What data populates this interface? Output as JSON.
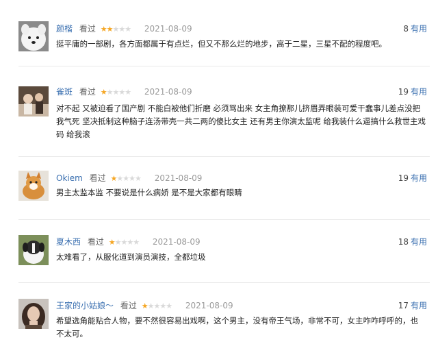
{
  "reviews": [
    {
      "user": "颜楷",
      "watched": "看过",
      "rating": 2,
      "date": "2021-08-09",
      "useful_count": "8",
      "useful_label": "有用",
      "content": "挺平庸的一部剧，各方面都属于有点烂，但又不那么烂的地步，高于二星，三星不配的程度吧。"
    },
    {
      "user": "雀斑",
      "watched": "看过",
      "rating": 1,
      "date": "2021-08-09",
      "useful_count": "19",
      "useful_label": "有用",
      "content": "对不起 又被迫看了国产剧 不能白被他们折磨 必须骂出来 女主角撩那儿挤眉弄眼装可爱干蠢事儿差点没把我气死 坚决抵制这种脑子连汤带壳一共二两的傻比女主 还有男主你演太监呢 给我装什么逼搞什么救世主戏码 给我滚"
    },
    {
      "user": "Okiem",
      "watched": "看过",
      "rating": 1,
      "date": "2021-08-09",
      "useful_count": "19",
      "useful_label": "有用",
      "content": "男主太监本监 不要说是什么病娇 是不是大家都有眼睛"
    },
    {
      "user": "夏木西",
      "watched": "看过",
      "rating": 1,
      "date": "2021-08-09",
      "useful_count": "18",
      "useful_label": "有用",
      "content": "太难看了，从服化道到演员演技，全都垃圾"
    },
    {
      "user": "王家的小姑娘～",
      "watched": "看过",
      "rating": 1,
      "date": "2021-08-09",
      "useful_count": "17",
      "useful_label": "有用",
      "content": "希望选角能贴合人物，要不然很容易出戏啊，这个男主，没有帝王气场，非常不可，女主咋咋呼呼的，也不太可。"
    }
  ],
  "colors": {
    "star_on": "#f5a623",
    "star_off": "#d9d9d9",
    "link": "#3a6fb0"
  }
}
